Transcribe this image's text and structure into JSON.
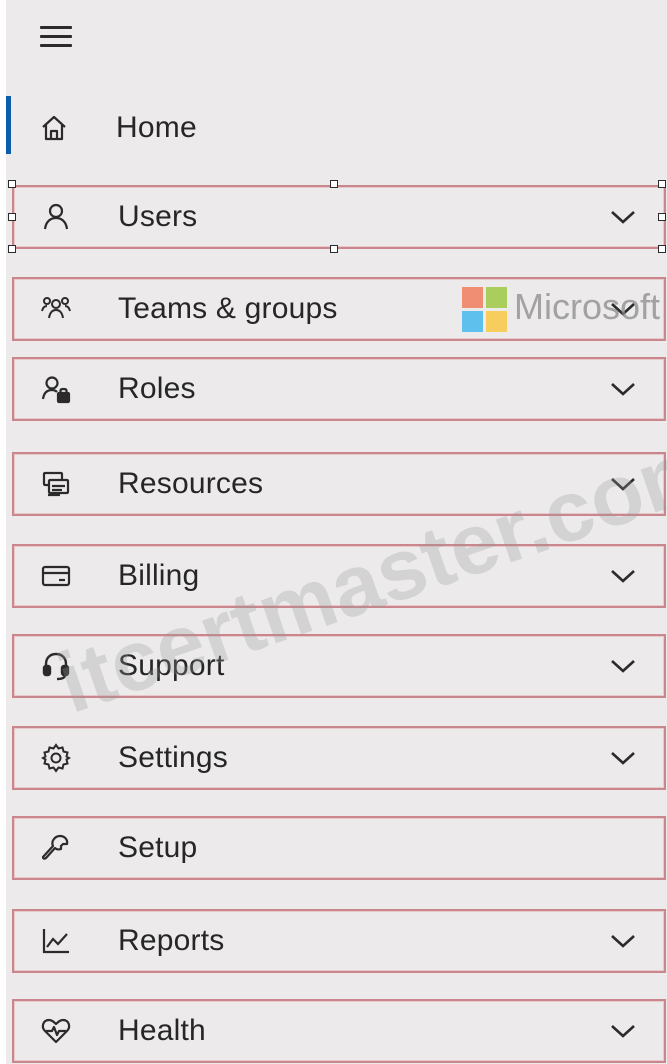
{
  "menu": {
    "hamburger_icon": "hamburger-menu-icon"
  },
  "nav": {
    "items": [
      {
        "label": "Home",
        "icon": "home-icon",
        "chevron": false,
        "active": true
      },
      {
        "label": "Users",
        "icon": "user-icon",
        "chevron": true,
        "selected": true
      },
      {
        "label": "Teams & groups",
        "icon": "teams-groups-icon",
        "chevron": true
      },
      {
        "label": "Roles",
        "icon": "roles-icon",
        "chevron": true
      },
      {
        "label": "Resources",
        "icon": "resources-icon",
        "chevron": true
      },
      {
        "label": "Billing",
        "icon": "billing-card-icon",
        "chevron": true
      },
      {
        "label": "Support",
        "icon": "headset-icon",
        "chevron": true
      },
      {
        "label": "Settings",
        "icon": "gear-icon",
        "chevron": true
      },
      {
        "label": "Setup",
        "icon": "wrench-icon",
        "chevron": false
      },
      {
        "label": "Reports",
        "icon": "line-chart-icon",
        "chevron": true
      },
      {
        "label": "Health",
        "icon": "heart-pulse-icon",
        "chevron": true
      }
    ]
  },
  "watermarks": {
    "brand": "Microsoft",
    "site": "itcertmaster.com"
  },
  "colors": {
    "panel_bg": "#eceaeb",
    "active_indicator": "#0b5cad",
    "highlight_border": "#c9868c",
    "text": "#262626"
  }
}
